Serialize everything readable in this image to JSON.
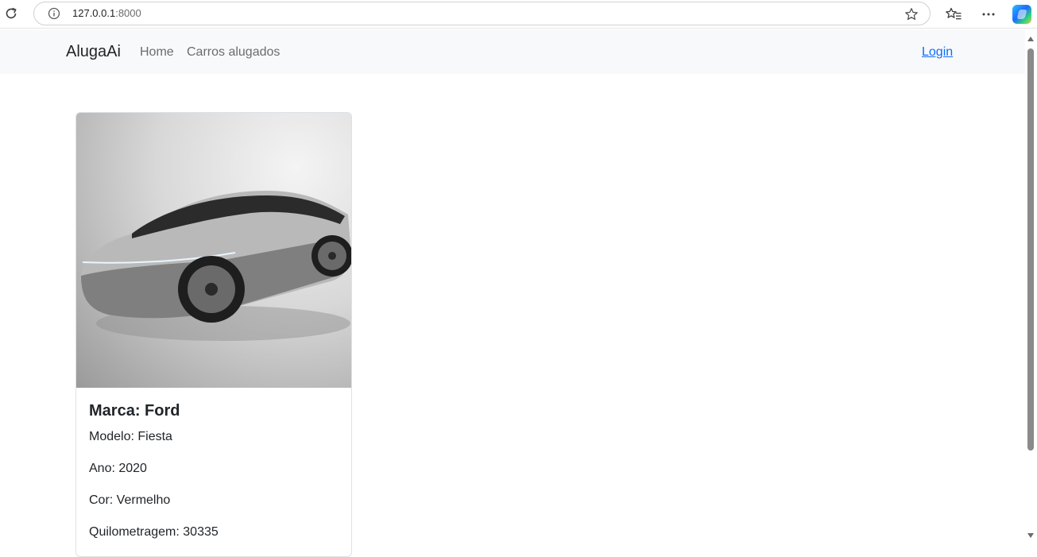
{
  "browser": {
    "url_host": "127.0.0.1",
    "url_port": ":8000",
    "icons": [
      "reload-icon",
      "info-icon",
      "star-icon",
      "favorites-icon",
      "more-icon",
      "copilot-icon"
    ]
  },
  "navbar": {
    "brand": "AlugaAi",
    "links": [
      {
        "label": "Home"
      },
      {
        "label": "Carros alugados"
      }
    ],
    "login": "Login"
  },
  "cards": [
    {
      "title": "Marca: Ford",
      "lines": [
        "Modelo: Fiesta",
        "Ano: 2020",
        "Cor: Vermelho",
        "Quilometragem: 30335"
      ],
      "image": "silver-concept-car"
    }
  ],
  "colors": {
    "navbar_bg": "#f8f9fa",
    "link": "#0d6efd",
    "text": "#212529",
    "nav_text": "#6c6c6c"
  }
}
